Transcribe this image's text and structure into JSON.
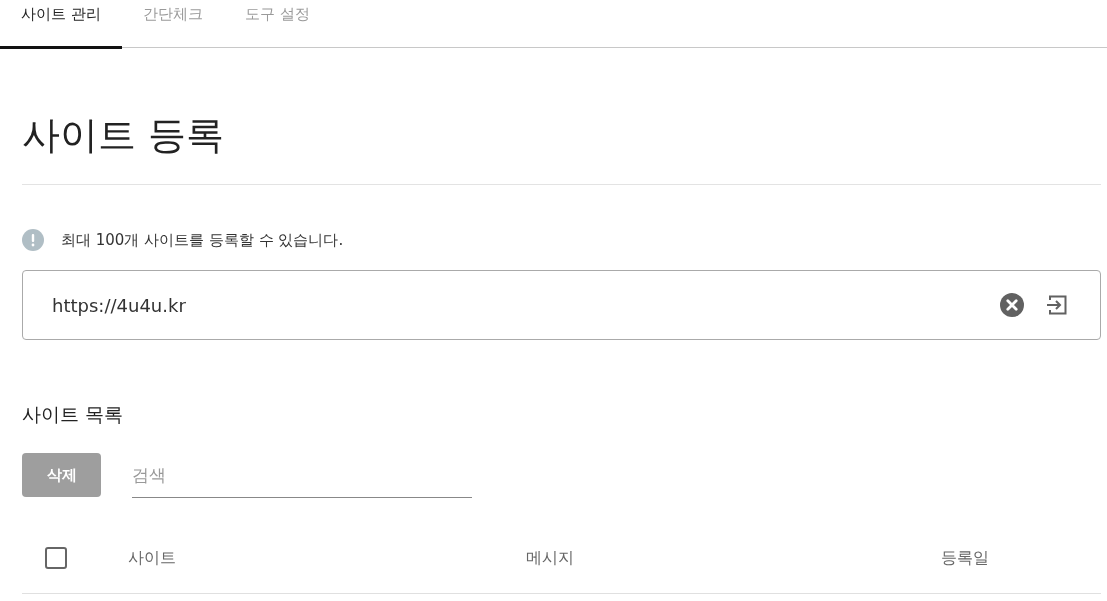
{
  "tabs": [
    {
      "label": "사이트 관리",
      "selected": true
    },
    {
      "label": "간단체크",
      "selected": false
    },
    {
      "label": "도구 설정",
      "selected": false
    }
  ],
  "heading": "사이트 등록",
  "notice": {
    "text": "최대 100개 사이트를 등록할 수 있습니다."
  },
  "url_field": {
    "value": "https://4u4u.kr"
  },
  "site_list": {
    "title": "사이트 목록",
    "delete_button": {
      "label": "삭제",
      "disabled": true
    },
    "search": {
      "placeholder": "검색"
    },
    "table": {
      "select_all": {
        "checked": false
      },
      "columns": [
        "사이트",
        "메시지",
        "등록일"
      ]
    }
  }
}
